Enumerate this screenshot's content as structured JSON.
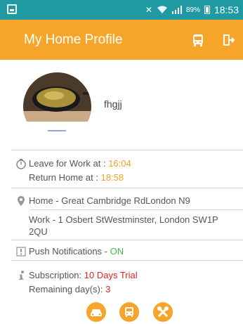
{
  "status_bar": {
    "battery": "89%",
    "time": "18:53",
    "icons": [
      "gallery-notification-icon",
      "mute-vibrate-icon",
      "wifi-icon",
      "signal-icon",
      "battery-icon"
    ]
  },
  "app_bar": {
    "title": "My Home Profile",
    "actions": [
      "bus-icon",
      "exit-icon"
    ]
  },
  "profile": {
    "username": "fhgjj"
  },
  "times": {
    "leave_label": "Leave for Work at : ",
    "leave_value": "16:04",
    "return_label": "Return Home at :  ",
    "return_value": "18:58"
  },
  "addresses": {
    "home": "Home - Great Cambridge RdLondon N9",
    "work_line1": "Work - 1 Osbert StWestminster, London SW1P",
    "work_line2": "2QU"
  },
  "notifications": {
    "label": "Push Notifications - ",
    "value": "ON"
  },
  "subscription": {
    "label": "Subscription: ",
    "value": "10 Days Trial",
    "remaining_label": "Remaining day(s):  ",
    "remaining_value": "3"
  },
  "bottom_actions": [
    "car-icon",
    "bus-icon",
    "tools-icon"
  ],
  "colors": {
    "status_bar": "#1f9aa3",
    "app_bar": "#f7a52a",
    "accent_orange": "#f0a12a",
    "on_green": "#42b649",
    "trial_red": "#e02424"
  }
}
